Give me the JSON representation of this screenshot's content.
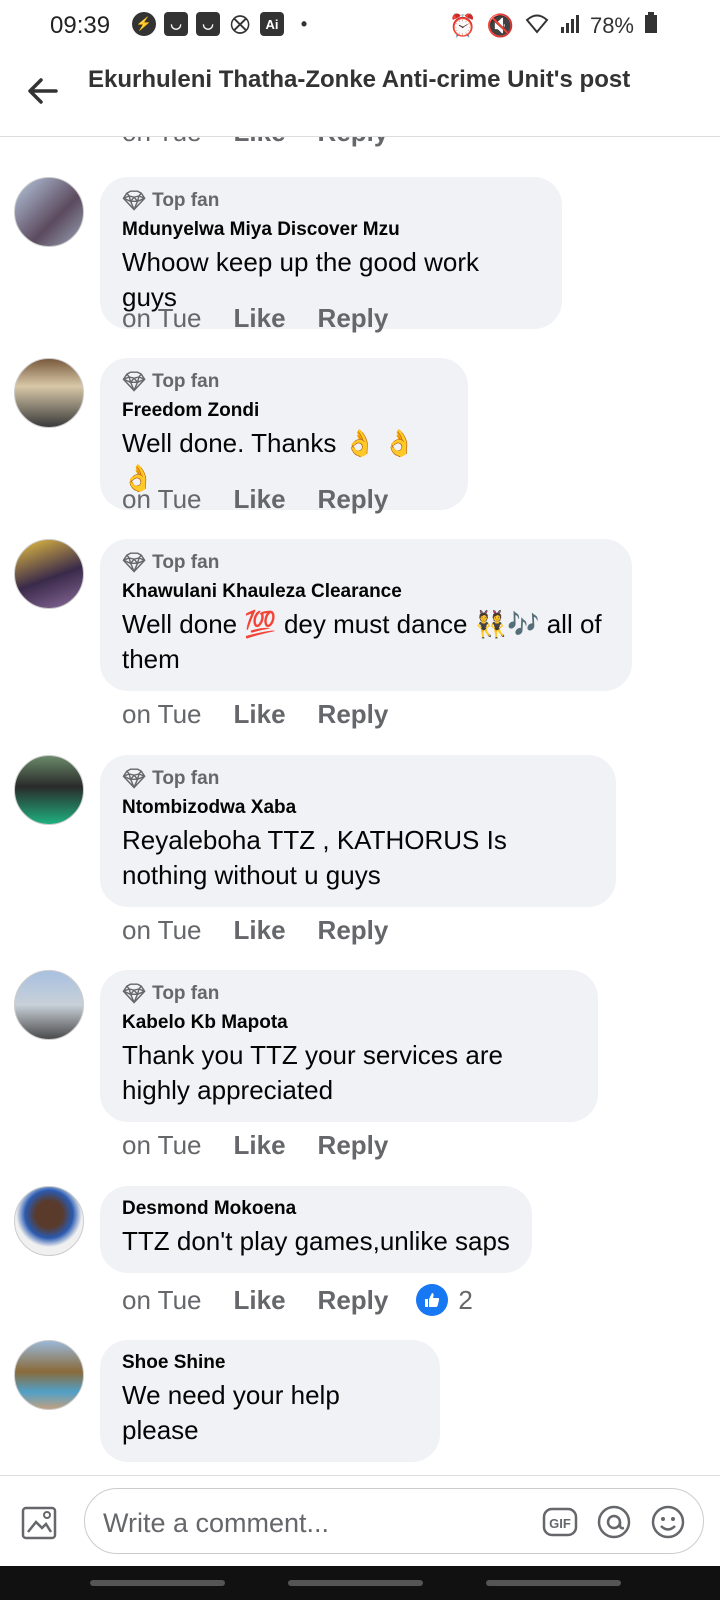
{
  "status": {
    "time": "09:39",
    "battery": "78%"
  },
  "header": {
    "title": "Ekurhuleni Thatha-Zonke Anti-crime Unit's post"
  },
  "partial_top": {
    "time": "on Tue",
    "like": "Like",
    "reply": "Reply"
  },
  "comments": [
    {
      "top_fan": "Top fan",
      "author": "Mdunyelwa Miya Discover Mzu",
      "text": "Whoow keep up the good work guys",
      "time": "on Tue",
      "like": "Like",
      "reply": "Reply"
    },
    {
      "top_fan": "Top fan",
      "author": "Freedom Zondi",
      "text": "Well done. Thanks 👌 👌 👌",
      "time": "on Tue",
      "like": "Like",
      "reply": "Reply"
    },
    {
      "top_fan": "Top fan",
      "author": "Khawulani Khauleza Clearance",
      "text": "Well done 💯 dey must dance 👯🎶 all of them",
      "time": "on Tue",
      "like": "Like",
      "reply": "Reply"
    },
    {
      "top_fan": "Top fan",
      "author": "Ntombizodwa Xaba",
      "text": "Reyaleboha  TTZ , KATHORUS Is nothing without u guys",
      "time": "on Tue",
      "like": "Like",
      "reply": "Reply"
    },
    {
      "top_fan": "Top fan",
      "author": "Kabelo Kb Mapota",
      "text": "Thank you TTZ your services are highly appreciated",
      "time": "on Tue",
      "like": "Like",
      "reply": "Reply"
    },
    {
      "author": "Desmond Mokoena",
      "text": "TTZ don't play games,unlike saps",
      "time": "on Tue",
      "like": "Like",
      "reply": "Reply",
      "reactions": "2"
    },
    {
      "author": "Shoe Shine",
      "text": "We need your help please"
    }
  ],
  "composer": {
    "placeholder": "Write a comment...",
    "gif": "GIF"
  },
  "icons": {
    "back": "arrow-left-icon",
    "top_fan": "diamond-icon",
    "photo": "photo-icon",
    "gif": "gif-icon",
    "mention": "at-icon",
    "emoji": "smiley-icon",
    "like_reaction": "thumbs-up-icon"
  },
  "colors": {
    "accent": "#1877f2",
    "bubble": "#f0f2f5",
    "secondary_text": "#65676b"
  }
}
